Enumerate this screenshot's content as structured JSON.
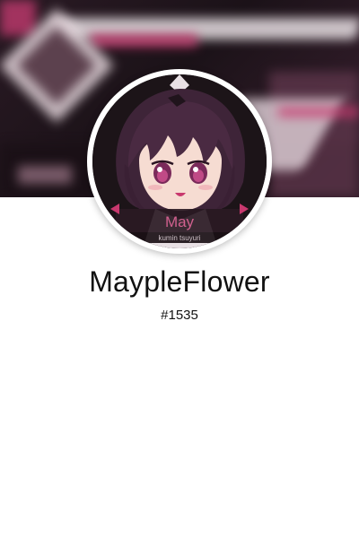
{
  "profile": {
    "username": "MaypleFlower",
    "discriminator": "#1535"
  },
  "avatar": {
    "name_plate": "May",
    "caption": "kumin tsuyuri"
  },
  "colors": {
    "accent_pink": "#c8386e",
    "banner_dark": "#1b1218",
    "hair": "#3e2438"
  }
}
